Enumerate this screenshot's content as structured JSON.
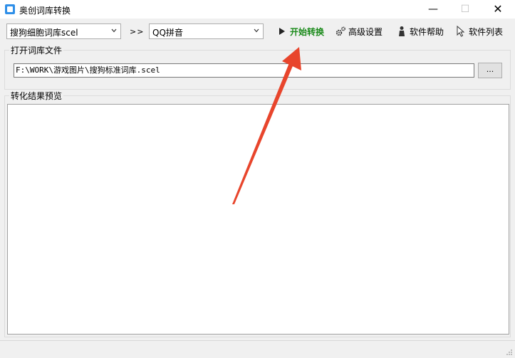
{
  "window": {
    "title": "奥创词库转换",
    "minimize_glyph": "—",
    "maximize_glyph": "☐",
    "close_glyph": "✕"
  },
  "toolbar": {
    "source_format": "搜狗细胞词库scel",
    "separator": ">>",
    "target_format": "QQ拼音",
    "start_label": "开始转换",
    "advanced_label": "高级设置",
    "help_label": "软件帮助",
    "list_label": "软件列表",
    "icons": {
      "start": "play-icon",
      "advanced": "gears-icon",
      "help": "person-icon",
      "list": "cursor-icon"
    }
  },
  "open_file": {
    "legend": "打开词库文件",
    "path_value": "F:\\WORK\\游戏图片\\搜狗标准词库.scel",
    "browse_label": "..."
  },
  "preview": {
    "legend": "转化结果预览",
    "content": ""
  },
  "colors": {
    "start_text": "#1a8a1a",
    "annotation_arrow": "#e8452c",
    "app_icon": "#2f8fe8"
  }
}
